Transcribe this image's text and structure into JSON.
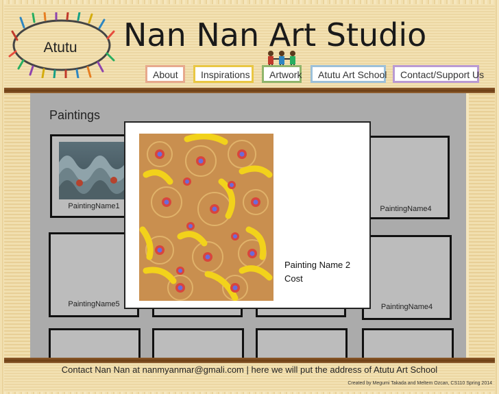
{
  "header": {
    "logo_text": "Atutu",
    "site_title": "Nan Nan Art Studio"
  },
  "nav": {
    "items": [
      {
        "label": "About",
        "color": "#e7a98d"
      },
      {
        "label": "Inspirations",
        "color": "#e9c743"
      },
      {
        "label": "Artwork",
        "color": "#8fb46b"
      },
      {
        "label": "Atutu Art School",
        "color": "#9cc0d9"
      },
      {
        "label": "Contact/Support Us",
        "color": "#b99ad3"
      }
    ]
  },
  "main": {
    "section_title": "Paintings",
    "tiles": [
      {
        "caption": "PaintingName1"
      },
      {
        "caption": ""
      },
      {
        "caption": ""
      },
      {
        "caption": "PaintingName4"
      },
      {
        "caption": "PaintingName5"
      },
      {
        "caption": ""
      },
      {
        "caption": ""
      },
      {
        "caption": "PaintingName4"
      },
      {
        "caption": ""
      },
      {
        "caption": ""
      },
      {
        "caption": ""
      },
      {
        "caption": ""
      }
    ]
  },
  "modal": {
    "painting_name": "Painting Name 2",
    "cost_label": "Cost"
  },
  "footer": {
    "contact_text": "Contact Nan Nan at nanmyanmar@gmali.com  |  here we will put the address of Atutu Art School",
    "credit": "Created by Megumi Takada and Meltem Ozcan, CS110 Spring 2014"
  }
}
